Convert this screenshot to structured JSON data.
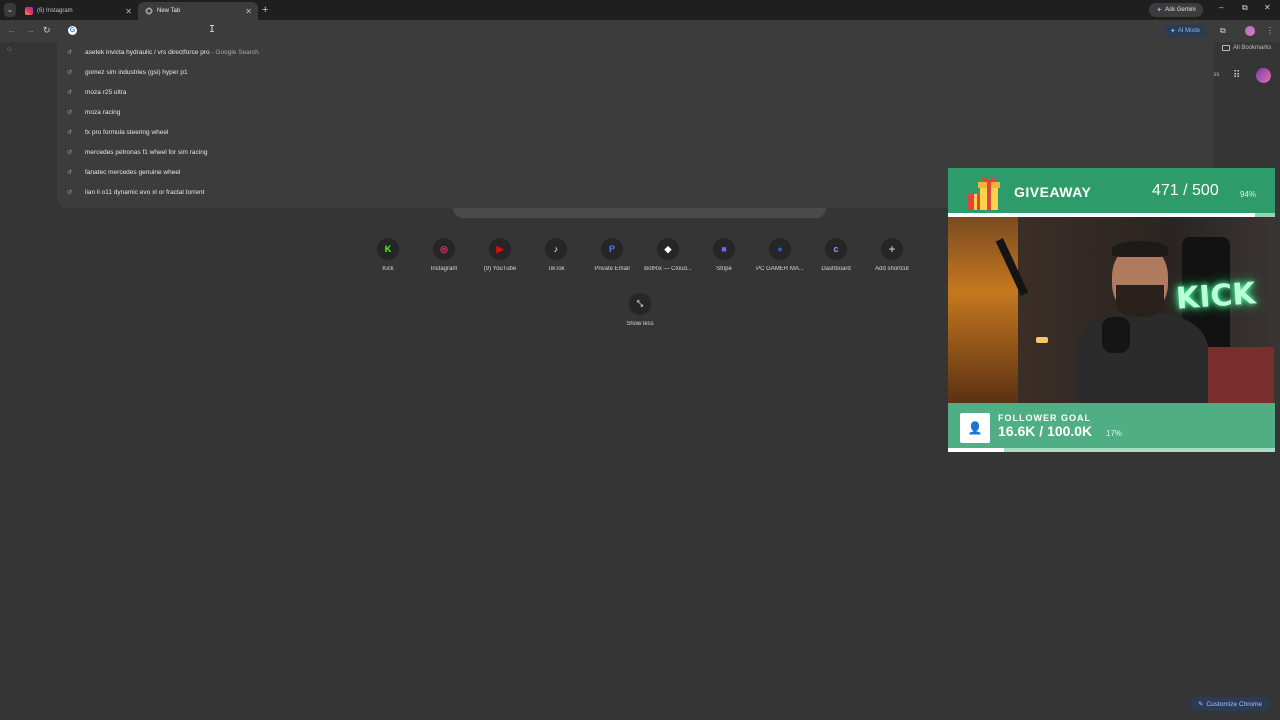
{
  "tabs": [
    {
      "title": "(6) Instagram",
      "favicon": "instagram-icon",
      "active": false
    },
    {
      "title": "New Tab",
      "favicon": "chrome-icon",
      "active": true
    }
  ],
  "toolbar": {
    "ask_gemini": "Ask Gemini",
    "ai_mode": "AI Mode",
    "omnibox_badge": "G"
  },
  "bookmarks": {
    "all_bookmarks": "All Bookmarks"
  },
  "suggestions": [
    {
      "text": "asetek invicta hydraulic / vrs directforce pro",
      "suffix": " - Google Search"
    },
    {
      "text": "gomez sim industries (gsi) hyper p1",
      "suffix": ""
    },
    {
      "text": "moza r25 ultra",
      "suffix": ""
    },
    {
      "text": "moza racing",
      "suffix": ""
    },
    {
      "text": "fx pro formula steering wheel",
      "suffix": ""
    },
    {
      "text": "mercedes petronas f1 wheel for sim racing",
      "suffix": ""
    },
    {
      "text": "fanatec mercedes genuine wheel",
      "suffix": ""
    },
    {
      "text": "lian li o11 dynamic evo xl or fractal torrent",
      "suffix": ""
    }
  ],
  "shortcuts": [
    {
      "label": "Kick",
      "glyph": "K",
      "color": "#53fc18"
    },
    {
      "label": "Instagram",
      "glyph": "◎",
      "color": "#e1306c"
    },
    {
      "label": "(9) YouTube",
      "glyph": "▶",
      "color": "#ff0000"
    },
    {
      "label": "TikTok",
      "glyph": "♪",
      "color": "#ffffff"
    },
    {
      "label": "Private Email",
      "glyph": "P",
      "color": "#4a7bff"
    },
    {
      "label": "BotRix — Cloud...",
      "glyph": "◆",
      "color": "#ffffff"
    },
    {
      "label": "Stripe",
      "glyph": "■",
      "color": "#7c5cff"
    },
    {
      "label": "PC GAMER MA...",
      "glyph": "●",
      "color": "#2c5cc5"
    },
    {
      "label": "Dashboard",
      "glyph": "c",
      "color": "#b58cff"
    },
    {
      "label": "Add shortcut",
      "glyph": "+",
      "color": "#e3e3e3"
    }
  ],
  "show_less": "Show less",
  "giveaway": {
    "title": "GIVEAWAY",
    "count": "471 / 500",
    "percent": "94%",
    "progress": 0.94
  },
  "webcam": {
    "neon_sign": "KICK"
  },
  "follower_goal": {
    "title": "FOLLOWER GOAL",
    "count": "16.6K / 100.0K",
    "percent": "17%",
    "progress": 0.17
  },
  "customize_chrome": "Customize Chrome",
  "colors": {
    "accent": "#8ab4f8",
    "giveaway_green": "#2e9c6a",
    "follower_green": "#4fae84"
  }
}
